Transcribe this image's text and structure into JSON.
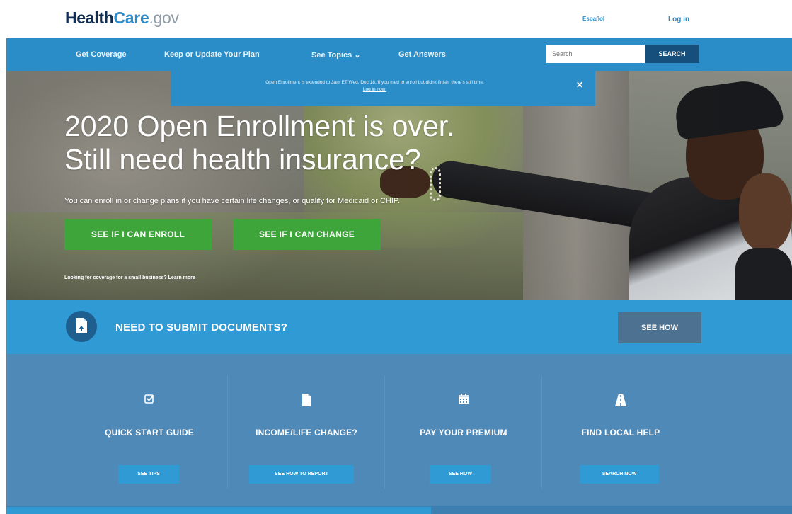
{
  "header": {
    "logo": {
      "part1": "Health",
      "part2": "Care",
      "part3": ".gov"
    },
    "language_link": "Español",
    "login_link": "Log in"
  },
  "nav": {
    "items": [
      {
        "label": "Get Coverage"
      },
      {
        "label": "Keep or Update Your Plan"
      },
      {
        "label": "See Topics ⌄"
      },
      {
        "label": "Get Answers"
      }
    ],
    "search": {
      "placeholder": "Search",
      "button": "SEARCH"
    }
  },
  "alert": {
    "text": "Open Enrollment is extended to 3am ET Wed, Dec 18. If you tried to enroll but didn't finish, there's still time.",
    "link": "Log in now!",
    "close": "✕"
  },
  "hero": {
    "title_line1": "2020 Open Enrollment is over.",
    "title_line2": "Still need health insurance?",
    "subtitle": "You can enroll in or change plans if you have certain life changes, or qualify for Medicaid or CHIP.",
    "button_enroll": "SEE IF I CAN ENROLL",
    "button_change": "SEE IF I CAN CHANGE",
    "small_business_text": "Looking for coverage for a small business? ",
    "small_business_link": "Learn more"
  },
  "documents": {
    "title": "NEED TO SUBMIT DOCUMENTS?",
    "button": "SEE HOW",
    "icon": "document-upload-icon"
  },
  "features": [
    {
      "icon": "checkbox-icon",
      "title": "QUICK START GUIDE",
      "button": "SEE TIPS"
    },
    {
      "icon": "document-icon",
      "title": "INCOME/LIFE CHANGE?",
      "button": "SEE HOW TO REPORT"
    },
    {
      "icon": "calendar-icon",
      "title": "PAY YOUR PREMIUM",
      "button": "SEE HOW"
    },
    {
      "icon": "road-icon",
      "title": "FIND LOCAL HELP",
      "button": "SEARCH NOW"
    }
  ],
  "colors": {
    "nav_blue": "#2b8dc7",
    "brand_navy": "#112e51",
    "green": "#3ea53b",
    "docs_blue": "#2f9ad3",
    "features_blue": "#4f89b8"
  }
}
